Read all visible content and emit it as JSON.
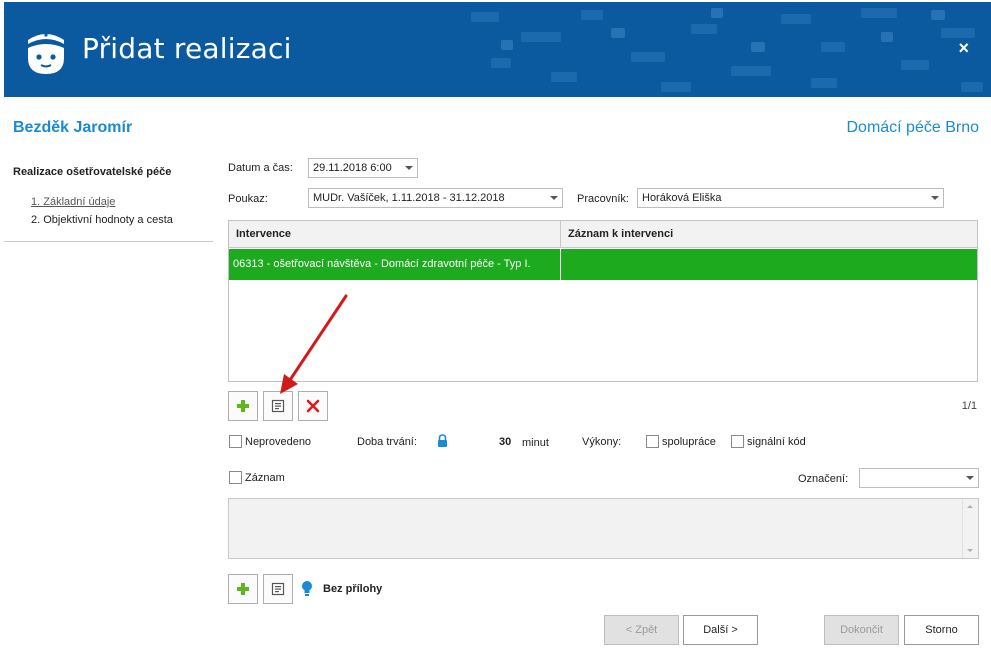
{
  "header": {
    "title": "Přidat realizaci",
    "close_label": "×",
    "logo_icon": "nurse-icon",
    "background_color": "#0b5aa0"
  },
  "patient": {
    "name": "Bezděk Jaromír",
    "organization": "Domácí péče Brno"
  },
  "sidebar": {
    "title": "Realizace ošetřovatelské péče",
    "steps": [
      {
        "label": "1. Základní údaje",
        "active": true
      },
      {
        "label": "2. Objektivní hodnoty a cesta",
        "active": false
      }
    ]
  },
  "form": {
    "datetime_label": "Datum a čas:",
    "datetime_value": "29.11.2018 6:00",
    "voucher_label": "Poukaz:",
    "voucher_value": "MUDr. Vašíček, 1.11.2018 - 31.12.2018",
    "worker_label": "Pracovník:",
    "worker_value": "Horáková Eliška"
  },
  "grid": {
    "columns": [
      "Intervence",
      "Záznam k intervenci"
    ],
    "rows": [
      {
        "intervence": "06313 - ošetřovací návštěva - Domácí zdravotní péče - Typ I.",
        "zaznam": ""
      }
    ],
    "selected_row_color": "#1eaa1e",
    "pager": "1/1"
  },
  "toolbar": {
    "add_icon": "plus-icon",
    "edit_icon": "note-icon",
    "delete_icon": "delete-x-icon"
  },
  "details": {
    "not_performed_label": "Neprovedeno",
    "duration_label": "Doba trvání:",
    "duration_value": "30",
    "duration_unit": "minut",
    "lock_icon": "lock-icon",
    "procedures_label": "Výkony:",
    "cooperation_label": "spolupráce",
    "signal_code_label": "signální kód",
    "record_label": "Záznam",
    "marking_label": "Označení:",
    "marking_value": ""
  },
  "attachments": {
    "add_icon": "plus-icon",
    "note_icon": "note-icon",
    "bulb_icon": "lightbulb-icon",
    "label": "Bez přílohy"
  },
  "footer": {
    "back_label": "< Zpět",
    "next_label": "Další >",
    "finish_label": "Dokončit",
    "cancel_label": "Storno"
  }
}
